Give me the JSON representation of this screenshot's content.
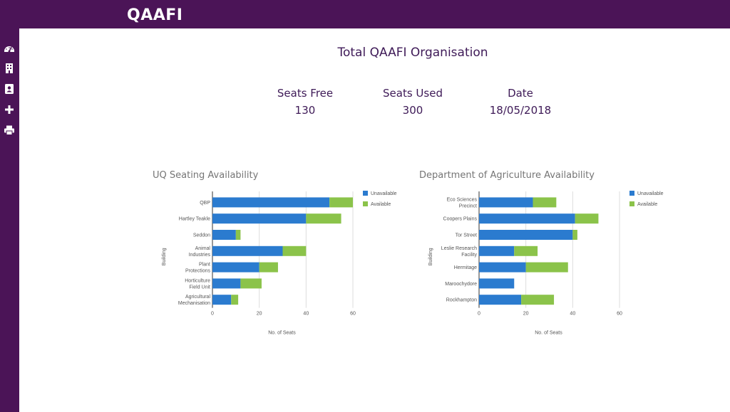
{
  "app": {
    "brand": "QAAFI"
  },
  "sidebar": {
    "items": [
      {
        "icon": "dashboard-icon"
      },
      {
        "icon": "building-icon"
      },
      {
        "icon": "contacts-icon"
      },
      {
        "icon": "plus-icon"
      },
      {
        "icon": "print-icon"
      }
    ]
  },
  "main": {
    "title": "Total QAAFI Organisation",
    "stats": [
      {
        "label": "Seats Free",
        "value": "130"
      },
      {
        "label": "Seats Used",
        "value": "300"
      },
      {
        "label": "Date",
        "value": "18/05/2018"
      }
    ]
  },
  "colors": {
    "header": "#4b1457",
    "unavailable": "#2b7bcf",
    "available": "#8bc34a",
    "text": "#3e1a57"
  },
  "chart_data": [
    {
      "type": "bar",
      "orientation": "horizontal",
      "stacked": true,
      "title": "UQ Seating Availability",
      "xlabel": "No. of Seats",
      "ylabel": "Building",
      "xlim": [
        0,
        60
      ],
      "xticks": [
        "0",
        "20",
        "40",
        "60"
      ],
      "legend_position": "right",
      "grid": true,
      "categories": [
        [
          "QBP"
        ],
        [
          "Hartley Teakle"
        ],
        [
          "Seddon"
        ],
        [
          "Animal",
          "Industries"
        ],
        [
          "Plant",
          "Protections"
        ],
        [
          "Horticulture",
          "Field Unit"
        ],
        [
          "Agricultural",
          "Mechanisation"
        ]
      ],
      "series": [
        {
          "name": "Unavailable",
          "values": [
            50,
            40,
            10,
            30,
            20,
            12,
            8
          ]
        },
        {
          "name": "Available",
          "values": [
            10,
            15,
            2,
            10,
            8,
            9,
            3
          ]
        }
      ]
    },
    {
      "type": "bar",
      "orientation": "horizontal",
      "stacked": true,
      "title": "Department of Agriculture Availability",
      "xlabel": "No. of Seats",
      "ylabel": "Building",
      "xlim": [
        0,
        60
      ],
      "xticks": [
        "0",
        "20",
        "40",
        "60"
      ],
      "legend_position": "right",
      "grid": true,
      "categories": [
        [
          "Eco Sciences",
          "Precinct"
        ],
        [
          "Coopers Plains"
        ],
        [
          "Tor Street"
        ],
        [
          "Leslie Research",
          "Facility"
        ],
        [
          "Hermitage"
        ],
        [
          "Maroochydore"
        ],
        [
          "Rockhampton"
        ]
      ],
      "series": [
        {
          "name": "Unavailable",
          "values": [
            23,
            41,
            40,
            15,
            20,
            15,
            18
          ]
        },
        {
          "name": "Available",
          "values": [
            10,
            10,
            2,
            10,
            18,
            0,
            14
          ]
        }
      ]
    }
  ]
}
